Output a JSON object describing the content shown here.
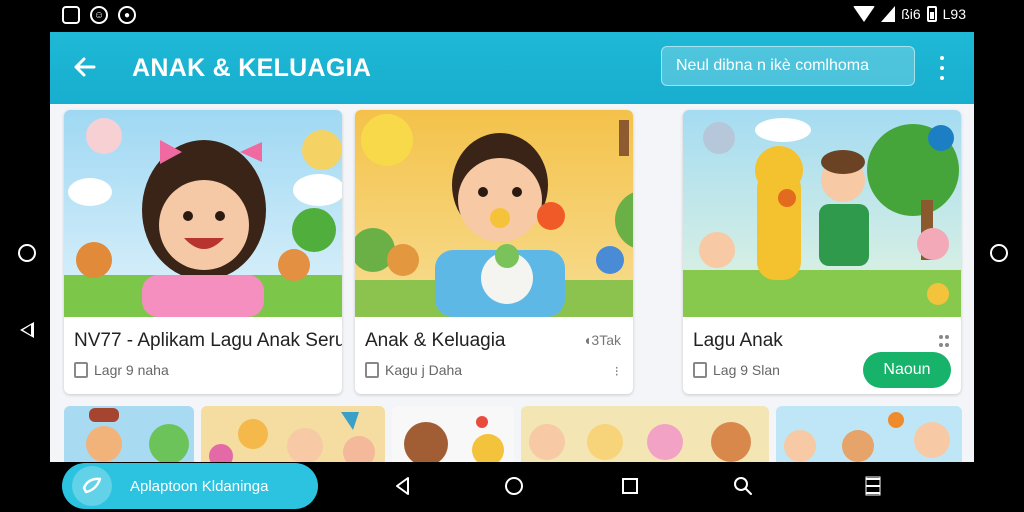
{
  "status_bar": {
    "left_icons": [
      "image-icon",
      "face-icon",
      "notification-icon"
    ],
    "signal_text": "ßi6",
    "battery_text": "L93"
  },
  "app_bar": {
    "title": "ANAK & KELUAGIA",
    "search_placeholder": "Neul dibna n ikè comlhoma"
  },
  "cards": [
    {
      "title": "NV77 - Aplikam Lagu Anak Seru",
      "subtitle": "Lagr 9 naha",
      "corner": ""
    },
    {
      "title": "Anak & Keluagia",
      "subtitle": "Kagu j Daha",
      "corner": "◖3Tak",
      "corner2": "⁝"
    },
    {
      "title": "Lagu Anak",
      "subtitle": "Lag 9 Slan",
      "button": "Naoun"
    }
  ],
  "fab": {
    "label": "Aplaptoon Kldaninga"
  },
  "colors": {
    "primary": "#1fb8d6",
    "accent": "#18b36b",
    "fab": "#2cc3e0"
  }
}
